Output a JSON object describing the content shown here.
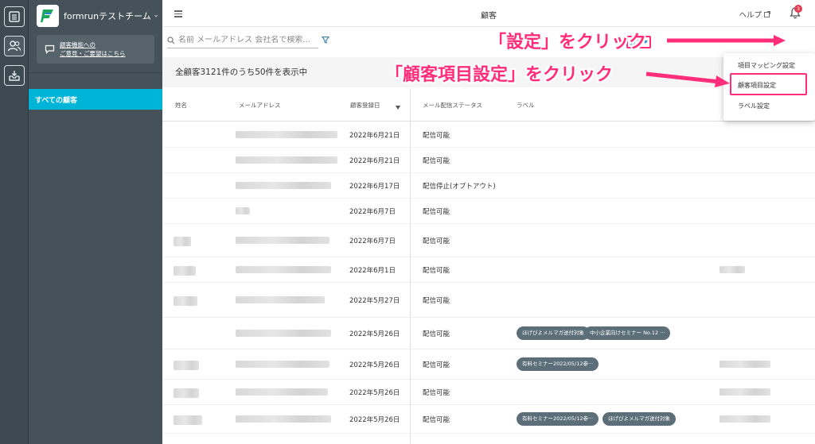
{
  "sidebar_rail": {
    "items": [
      {
        "name": "forms-icon"
      },
      {
        "name": "customers-icon"
      },
      {
        "name": "inbox-icon"
      }
    ]
  },
  "panel": {
    "team_name": "formrunテストチーム",
    "feedback_line1": "顧客機能への",
    "feedback_line2": "ご意見・ご要望はこちら",
    "nav_all_customers": "すべての顧客"
  },
  "topbar": {
    "title": "顧客",
    "help": "ヘルプ",
    "notification_count": "3"
  },
  "search": {
    "placeholder": "名前 メールアドレス 会社名で検索..."
  },
  "toolbar": {
    "settings_label": "設定"
  },
  "summary": {
    "text": "全顧客3121件のうち50件を表示中"
  },
  "table": {
    "headers": {
      "name": "姓名",
      "email": "メールアドレス",
      "registered": "顧客登録日",
      "mail_status": "メール配信ステータス",
      "label": "ラベル"
    },
    "rows": [
      {
        "date": "2022年6月21日",
        "status": "配信可能",
        "tags": []
      },
      {
        "date": "2022年6月21日",
        "status": "配信可能",
        "tags": []
      },
      {
        "date": "2022年6月17日",
        "status": "配信停止(オプトアウト)",
        "tags": []
      },
      {
        "date": "2022年6月7日",
        "status": "配信可能",
        "tags": []
      },
      {
        "date": "2022年6月7日",
        "status": "配信可能",
        "tags": []
      },
      {
        "date": "2022年6月1日",
        "status": "配信可能",
        "tags": []
      },
      {
        "date": "2022年5月27日",
        "status": "配信可能",
        "tags": []
      },
      {
        "date": "2022年5月26日",
        "status": "配信可能",
        "tags": [
          "ほげぴよメルマガ送付対象",
          "中小企業向けセミナー No.12 ···"
        ]
      },
      {
        "date": "2022年5月26日",
        "status": "配信可能",
        "tags": [
          "有料セミナー2022/05/12参···"
        ]
      },
      {
        "date": "2022年5月26日",
        "status": "配信可能",
        "tags": []
      },
      {
        "date": "2022年5月26日",
        "status": "配信可能",
        "tags": [
          "有料セミナー2022/05/12参···",
          "ほげぴよメルマガ送付対象"
        ]
      }
    ]
  },
  "dropdown": {
    "items": [
      "項目マッピング設定",
      "顧客項目設定",
      "ラベル設定"
    ]
  },
  "annotations": {
    "settings_click": "「設定」をクリック",
    "customer_fields_click": "「顧客項目設定」をクリック"
  },
  "colors": {
    "accent": "#00b4d8",
    "annotation": "#ff2d7a",
    "sidebar": "#465259",
    "tag": "#5c6e78"
  }
}
